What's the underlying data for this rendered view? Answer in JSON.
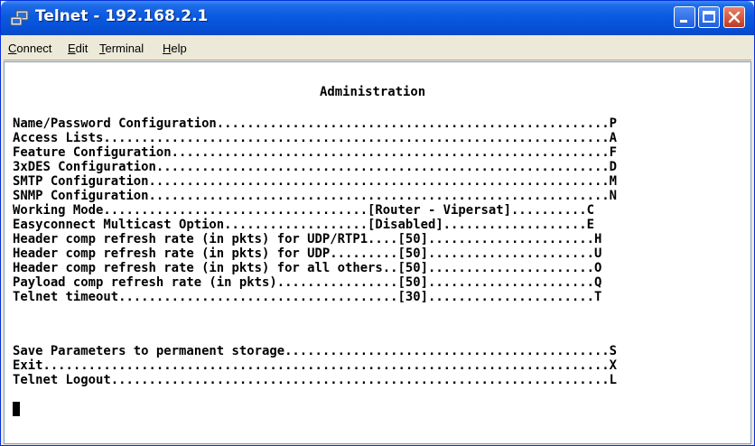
{
  "window": {
    "title": "Telnet - 192.168.2.1",
    "icon": "telnet-icon",
    "controls": [
      "minimize-icon",
      "maximize-icon",
      "close-icon"
    ],
    "colors": {
      "titlebar": "#0a5ae0",
      "close": "#c0391f"
    }
  },
  "menu": {
    "items": [
      {
        "accel": "C",
        "rest": "onnect"
      },
      {
        "accel": "E",
        "rest": "dit"
      },
      {
        "accel": "T",
        "rest": "erminal"
      },
      {
        "accel": "H",
        "rest": "elp"
      }
    ]
  },
  "terminal": {
    "title": "Administration",
    "options": [
      "Name/Password Configuration....................................................P",
      "Access Lists...................................................................A",
      "Feature Configuration..........................................................F",
      "3xDES Configuration............................................................D",
      "SMTP Configuration.............................................................M",
      "SNMP Configuration.............................................................N",
      "Working Mode...................................[Router - Vipersat]..........C",
      "Easyconnect Multicast Option...................[Disabled]...................E",
      "Header comp refresh rate (in pkts) for UDP/RTP1....[50]......................H",
      "Header comp refresh rate (in pkts) for UDP.........[50]......................U",
      "Header comp refresh rate (in pkts) for all others..[50]......................O",
      "Payload comp refresh rate (in pkts)................[50]......................Q",
      "Telnet timeout.....................................[30]......................T"
    ],
    "actions": [
      "Save Parameters to permanent storage...........................................S",
      "Exit...........................................................................X",
      "Telnet Logout..................................................................L"
    ]
  }
}
